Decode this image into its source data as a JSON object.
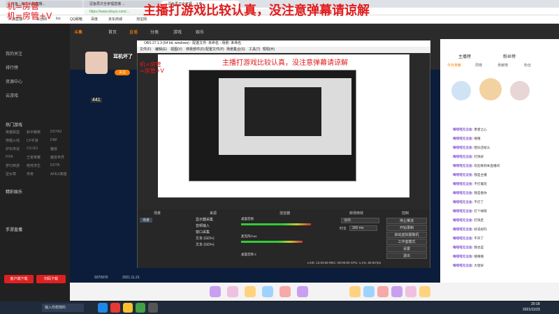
{
  "overlay": {
    "top_text": "主播打游戏比较认真，没注意弹幕请谅解",
    "left_line1": "机=房管",
    "left_line2": "机=房管+V",
    "inner_text": "主播打游戏比较认真，没注意弹幕请谅解",
    "inner_left1": "机=房管",
    "inner_left2": "=房管+V"
  },
  "browser": {
    "tabs": [
      "斗鱼 - 每个人的直播...",
      "逗鱼再次全家福直播 ...",
      "逗鱼再次全家福 - 斗鱼 ..."
    ],
    "url": "https://www.douyu.com/...",
    "bookmarks": [
      "人民直播",
      "青创网",
      "Ins",
      "QQ邮箱",
      "百度",
      "京东商城",
      "淘宝网"
    ]
  },
  "site": {
    "nav": [
      "首页",
      "直播",
      "分类",
      "游戏",
      "娱乐"
    ],
    "logo": "斗鱼"
  },
  "sidebar": {
    "items": [
      "我的关注",
      "排行榜",
      "资源中心",
      "云游戏"
    ],
    "sections": [
      "热门游戏",
      "精彩娱乐",
      "手游直播"
    ],
    "games": [
      [
        "英雄联盟",
        "和平精英",
        "DOTA2"
      ],
      [
        "穿越火线",
        "CF手游",
        "DNF"
      ],
      [
        "炉石传说",
        "CS:GO",
        "魔兽"
      ],
      [
        "FIFA",
        "王者荣耀",
        "魔兽世界"
      ],
      [
        "梦幻西游",
        "绝地求生",
        "DOTA"
      ],
      [
        "逆水寒",
        "传奇",
        "APEX英雄"
      ]
    ],
    "bottom_buttons": [
      "客户端下载",
      "扫码下载"
    ]
  },
  "room": {
    "title": "耳机坏了",
    "id": "9370970",
    "date": "2021.11.21",
    "follow": "关注",
    "badge": "441"
  },
  "obs": {
    "title": "OBS 27.1.3 (64 bit, windows) - 配置文件: 未命名 - 场景: 未命名",
    "menu": [
      "文件(F)",
      "编辑(E)",
      "视图(V)",
      "停靠部件(D)",
      "配置文件(P)",
      "场景集合(S)",
      "工具(T)",
      "帮助(H)"
    ],
    "docks": [
      "场景",
      "来源",
      "混音器",
      "转场特效",
      "控制"
    ],
    "scenes": [
      "场景"
    ],
    "sources": [
      "显示器采集",
      "音频输入",
      "窗口采集",
      "文本 (GDI+)",
      "文本 (GDI+)"
    ],
    "mixer": [
      "桌面音频",
      "麦克风/Aux",
      "桌面音频 2"
    ],
    "transition": "淡出",
    "duration": "300 ms",
    "duration_label": "时长",
    "controls": [
      "停止推流",
      "开始录制",
      "启动虚拟摄像机",
      "工作室模式",
      "设置",
      "退出"
    ],
    "status": "LIVE: 12:03:56  REC: 00:00:00  CPU: 1.1%, 60.00 fps"
  },
  "chat": {
    "tabs": [
      "主播榜",
      "粉丝榜"
    ],
    "subtabs": [
      "今日贡献",
      "周榜",
      "贡献榜",
      "粉丝"
    ],
    "messages": [
      [
        "嘀嗒嗒无法金:",
        "勇者之心"
      ],
      [
        "嘀嗒嗒无法金:",
        "嘻嘻"
      ],
      [
        "嘀嗒嗒无法金:",
        "咱乐还给么"
      ],
      [
        "嘀嗒嗒无法金:",
        "打快好"
      ],
      [
        "嘀嗒嗒无法金:",
        "欢迎来到本直播间"
      ],
      [
        "嘀嗒嗒无法金:",
        "我是主播"
      ],
      [
        "嘀嗒嗒无法金:",
        "不打着玩"
      ],
      [
        "嘀嗒嗒无法金:",
        "我是看你"
      ],
      [
        "嘀嗒嗒无法金:",
        "不打了"
      ],
      [
        "嘀嗒嗒无法金:",
        "打个样呀"
      ],
      [
        "嘀嗒嗒无法金:",
        "打快走"
      ],
      [
        "嘀嗒嗒无法金:",
        "好说好的"
      ],
      [
        "嘀嗒嗒无法金:",
        "不开了"
      ],
      [
        "嘀嗒嗒无法金:",
        "我也是"
      ],
      [
        "嘀嗒嗒无法金:",
        "嘻嘻嘻"
      ],
      [
        "嘀嗒嗒无法金:",
        "大佬好"
      ]
    ]
  },
  "taskbar": {
    "app": "输入你想搜的",
    "time": "20:18",
    "date": "2021/11/23"
  },
  "colors": {
    "accent": "#ff6a00",
    "danmaku": "#e21b1b",
    "douyu_orange": "#ff7e00"
  }
}
